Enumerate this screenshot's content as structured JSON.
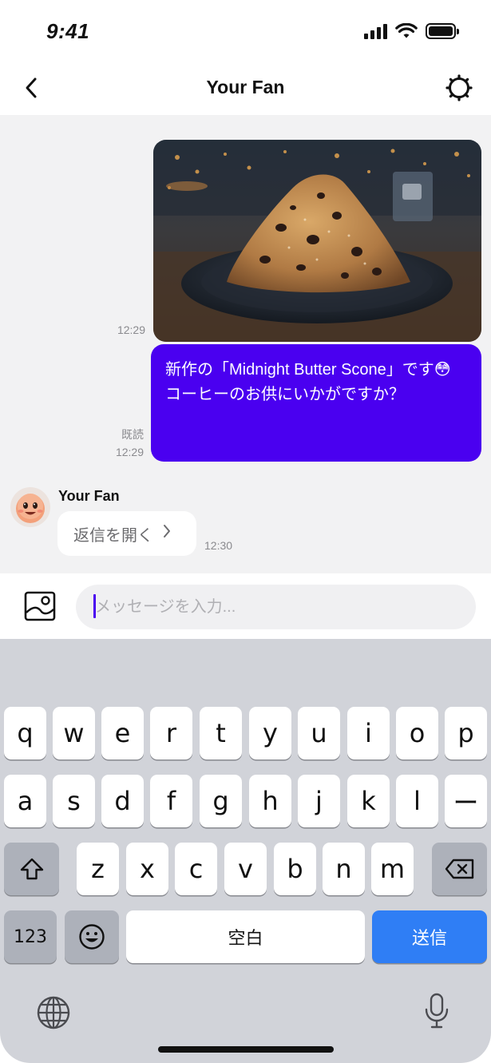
{
  "status_bar": {
    "time": "9:41"
  },
  "header": {
    "title": "Your Fan"
  },
  "messages": {
    "photo": {
      "time": "12:29"
    },
    "text": {
      "body": "新作の「Midnight Butter Scone」です😳 コーヒーのお供にいかがですか？",
      "read_label": "既読",
      "time": "12:29"
    },
    "incoming": {
      "sender": "Your Fan",
      "reply_label": "返信を開く",
      "time": "12:30"
    }
  },
  "composer": {
    "placeholder": "メッセージを入力..."
  },
  "keyboard": {
    "row1": [
      "q",
      "w",
      "e",
      "r",
      "t",
      "y",
      "u",
      "i",
      "o",
      "p"
    ],
    "row2": [
      "a",
      "s",
      "d",
      "f",
      "g",
      "h",
      "j",
      "k",
      "l",
      "ー"
    ],
    "row3": [
      "z",
      "x",
      "c",
      "v",
      "b",
      "n",
      "m"
    ],
    "numbers_label": "123",
    "space_label": "空白",
    "send_label": "送信"
  },
  "colors": {
    "accent": "#4a00f0",
    "send_key": "#2f7ef5",
    "chat_bg": "#f2f2f3",
    "keyboard_bg": "#d1d3d9"
  },
  "icons": [
    "back-icon",
    "settings-icon",
    "image-icon",
    "shift-icon",
    "backspace-icon",
    "emoji-icon",
    "globe-icon",
    "microphone-icon"
  ]
}
